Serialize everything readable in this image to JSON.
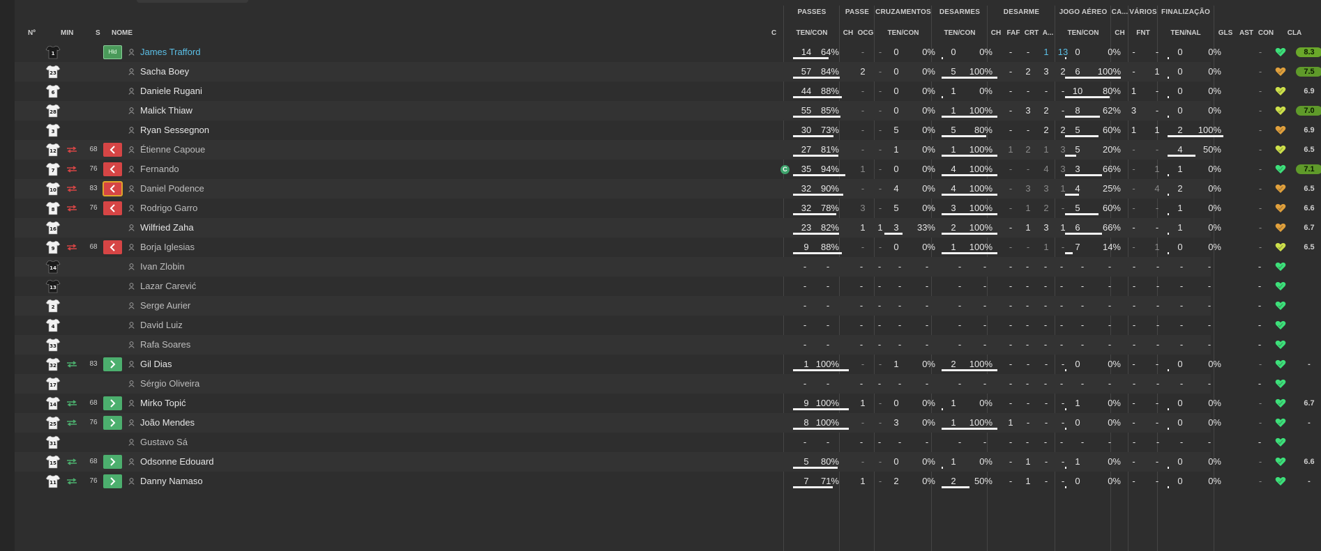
{
  "groups": [
    {
      "key": "passes",
      "label": "PASSES"
    },
    {
      "key": "passe",
      "label": "PASSE"
    },
    {
      "key": "cruz",
      "label": "CRUZAMENTOS"
    },
    {
      "key": "desarmes",
      "label": "DESARMES"
    },
    {
      "key": "desarme",
      "label": "DESARME"
    },
    {
      "key": "aereo",
      "label": "JOGO AÉREO"
    },
    {
      "key": "ca",
      "label": "CA..."
    },
    {
      "key": "varios",
      "label": "VÁRIOS"
    },
    {
      "key": "final",
      "label": "FINALIZAÇÃO"
    }
  ],
  "headers": {
    "num": "Nº",
    "min": "MIN",
    "s": "S",
    "nome": "NOME",
    "c": "C",
    "pass_tc": "TEN/CON",
    "passe_ch": "CH",
    "passe_ocg": "OCG",
    "cruz_tc": "TEN/CON",
    "des_tc": "TEN/CON",
    "d_ch": "CH",
    "d_faf": "FAF",
    "d_crt": "CRT",
    "d_a": "A...",
    "aer_tc": "TEN/CON",
    "ca_ch": "CH",
    "var_fnt": "FNT",
    "fin_tn": "TEN/NAL",
    "gls": "GLS",
    "ast": "AST",
    "con": "CON",
    "cla": "CLA"
  },
  "colors": {
    "sub_out": "#d64545",
    "sub_in": "#4caf6e",
    "link": "#5bbfe6",
    "heart_green": "#3de07a",
    "heart_yellow": "#cde04a",
    "heart_orange": "#e0a03c"
  },
  "players": [
    {
      "num": "1",
      "gk": true,
      "sub": "",
      "min": "",
      "s": "hld",
      "s_label": "Hld",
      "name": "James Trafford",
      "style": "link",
      "cap": "",
      "p1": "14",
      "p2": "64%",
      "pf": 0.64,
      "pch": "-",
      "pocg": "-",
      "c1": "0",
      "c2": "0%",
      "t1": "0",
      "t2": "0%",
      "tf": 0,
      "dch": "-",
      "dfaf": "-",
      "dcrt": "1",
      "da": "13",
      "dblue": true,
      "a1": "0",
      "a2": "0%",
      "af": 0,
      "cach": "-",
      "fnt": "-",
      "f1": "0",
      "f2": "0%",
      "ff": 0,
      "gls": "",
      "ast": "-",
      "heart": "green",
      "cla": "8.3",
      "cla_style": "best"
    },
    {
      "num": "23",
      "gk": false,
      "sub": "",
      "min": "",
      "s": "",
      "name": "Sacha Boey",
      "style": "white",
      "cap": "",
      "p1": "57",
      "p2": "84%",
      "pf": 0.84,
      "pch": "2",
      "pocg": "-",
      "c1": "0",
      "c2": "0%",
      "t1": "5",
      "t2": "100%",
      "tf": 1,
      "dch": "-",
      "dfaf": "2",
      "dcrt": "3",
      "da": "2",
      "a1": "6",
      "a2": "100%",
      "af": 1,
      "cach": "-",
      "fnt": "1",
      "f1": "0",
      "f2": "0%",
      "ff": 0,
      "gls": "",
      "ast": "-",
      "heart": "orange",
      "cla": "7.5",
      "cla_style": "good"
    },
    {
      "num": "6",
      "gk": false,
      "sub": "",
      "min": "",
      "s": "",
      "name": "Daniele Rugani",
      "style": "white",
      "cap": "",
      "p1": "44",
      "p2": "88%",
      "pf": 0.88,
      "pch": "-",
      "pocg": "-",
      "c1": "0",
      "c2": "0%",
      "t1": "1",
      "t2": "0%",
      "tf": 0,
      "dch": "-",
      "dfaf": "-",
      "dcrt": "-",
      "da": "-",
      "a1": "10",
      "a2": "80%",
      "af": 0.8,
      "cach": "1",
      "fnt": "-",
      "f1": "0",
      "f2": "0%",
      "ff": 0,
      "gls": "",
      "ast": "-",
      "heart": "yellow",
      "cla": "6.9",
      "cla_style": "plain"
    },
    {
      "num": "28",
      "gk": false,
      "sub": "",
      "min": "",
      "s": "",
      "name": "Malick Thiaw",
      "style": "white",
      "cap": "",
      "p1": "55",
      "p2": "85%",
      "pf": 0.85,
      "pch": "-",
      "pocg": "-",
      "c1": "0",
      "c2": "0%",
      "t1": "1",
      "t2": "100%",
      "tf": 1,
      "dch": "-",
      "dfaf": "3",
      "dcrt": "2",
      "da": "-",
      "a1": "8",
      "a2": "62%",
      "af": 0.62,
      "cach": "3",
      "fnt": "-",
      "f1": "0",
      "f2": "0%",
      "ff": 0,
      "gls": "",
      "ast": "-",
      "heart": "yellow",
      "cla": "7.0",
      "cla_style": "good"
    },
    {
      "num": "3",
      "gk": false,
      "sub": "",
      "min": "",
      "s": "",
      "name": "Ryan Sessegnon",
      "style": "white",
      "cap": "",
      "p1": "30",
      "p2": "73%",
      "pf": 0.73,
      "pch": "-",
      "pocg": "-",
      "c1": "5",
      "c2": "0%",
      "t1": "5",
      "t2": "80%",
      "tf": 0.8,
      "dch": "-",
      "dfaf": "-",
      "dcrt": "2",
      "da": "2",
      "a1": "5",
      "a2": "60%",
      "af": 0.6,
      "cach": "1",
      "fnt": "1",
      "f1": "2",
      "f2": "100%",
      "ff": 1,
      "gls": "",
      "ast": "-",
      "heart": "orange",
      "cla": "6.9",
      "cla_style": "plain"
    },
    {
      "num": "12",
      "gk": false,
      "sub": "out",
      "min": "68",
      "s": "out",
      "name": "Étienne Capoue",
      "style": "grey",
      "cap": "",
      "p1": "27",
      "p2": "81%",
      "pf": 0.81,
      "pch": "-",
      "pocg": "-",
      "c1": "1",
      "c2": "0%",
      "t1": "1",
      "t2": "100%",
      "tf": 1,
      "dch": "1",
      "dfaf": "2",
      "dcrt": "1",
      "da": "3",
      "a1": "5",
      "a2": "20%",
      "af": 0.2,
      "cach": "-",
      "fnt": "-",
      "f1": "4",
      "f2": "50%",
      "ff": 0.5,
      "gls": "",
      "ast": "-",
      "heart": "yellow",
      "cla": "6.5",
      "cla_style": "plain"
    },
    {
      "num": "7",
      "gk": false,
      "sub": "out",
      "min": "76",
      "s": "out",
      "name": "Fernando",
      "style": "grey",
      "cap": "C",
      "p1": "35",
      "p2": "94%",
      "pf": 0.94,
      "pch": "1",
      "pocg": "-",
      "c1": "0",
      "c2": "0%",
      "t1": "4",
      "t2": "100%",
      "tf": 1,
      "dch": "-",
      "dfaf": "-",
      "dcrt": "4",
      "da": "3",
      "a1": "3",
      "a2": "66%",
      "af": 0.66,
      "cach": "-",
      "fnt": "1",
      "f1": "1",
      "f2": "0%",
      "ff": 0,
      "gls": "",
      "ast": "-",
      "heart": "green",
      "cla": "7.1",
      "cla_style": "good"
    },
    {
      "num": "10",
      "gk": false,
      "sub": "out",
      "min": "83",
      "s": "out",
      "sel": true,
      "name": "Daniel Podence",
      "style": "grey",
      "cap": "",
      "p1": "32",
      "p2": "90%",
      "pf": 0.9,
      "pch": "-",
      "pocg": "-",
      "c1": "4",
      "c2": "0%",
      "t1": "4",
      "t2": "100%",
      "tf": 1,
      "dch": "-",
      "dfaf": "3",
      "dcrt": "3",
      "da": "1",
      "a1": "4",
      "a2": "25%",
      "af": 0.25,
      "cach": "-",
      "fnt": "4",
      "f1": "2",
      "f2": "0%",
      "ff": 0,
      "gls": "",
      "ast": "-",
      "heart": "orange",
      "cla": "6.5",
      "cla_style": "plain"
    },
    {
      "num": "8",
      "gk": false,
      "sub": "out",
      "min": "76",
      "s": "out",
      "name": "Rodrigo Garro",
      "style": "grey",
      "cap": "",
      "p1": "32",
      "p2": "78%",
      "pf": 0.78,
      "pch": "3",
      "pocg": "-",
      "c1": "5",
      "c2": "0%",
      "t1": "3",
      "t2": "100%",
      "tf": 1,
      "dch": "-",
      "dfaf": "1",
      "dcrt": "2",
      "da": "-",
      "a1": "5",
      "a2": "60%",
      "af": 0.6,
      "cach": "-",
      "fnt": "-",
      "f1": "1",
      "f2": "0%",
      "ff": 0,
      "gls": "",
      "ast": "-",
      "heart": "orange",
      "cla": "6.6",
      "cla_style": "plain"
    },
    {
      "num": "16",
      "gk": false,
      "sub": "",
      "min": "",
      "s": "",
      "name": "Wilfried Zaha",
      "style": "white",
      "cap": "",
      "p1": "23",
      "p2": "82%",
      "pf": 0.82,
      "pch": "1",
      "pocg": "1",
      "c1": "3",
      "c2": "33%",
      "cf": 0.33,
      "t1": "2",
      "t2": "100%",
      "tf": 1,
      "dch": "-",
      "dfaf": "1",
      "dcrt": "3",
      "da": "1",
      "a1": "6",
      "a2": "66%",
      "af": 0.66,
      "cach": "-",
      "fnt": "-",
      "f1": "1",
      "f2": "0%",
      "ff": 0,
      "gls": "",
      "ast": "-",
      "heart": "orange",
      "cla": "6.7",
      "cla_style": "plain"
    },
    {
      "num": "9",
      "gk": false,
      "sub": "out",
      "min": "68",
      "s": "out",
      "name": "Borja Iglesias",
      "style": "grey",
      "cap": "",
      "p1": "9",
      "p2": "88%",
      "pf": 0.88,
      "pch": "-",
      "pocg": "-",
      "c1": "0",
      "c2": "0%",
      "t1": "1",
      "t2": "100%",
      "tf": 1,
      "dch": "-",
      "dfaf": "-",
      "dcrt": "1",
      "da": "-",
      "a1": "7",
      "a2": "14%",
      "af": 0.14,
      "cach": "-",
      "fnt": "1",
      "f1": "0",
      "f2": "0%",
      "ff": 0,
      "gls": "",
      "ast": "-",
      "heart": "yellow",
      "cla": "6.5",
      "cla_style": "plain"
    },
    {
      "num": "14",
      "gk": true,
      "sub": "",
      "min": "",
      "s": "",
      "name": "Ivan Zlobin",
      "style": "grey",
      "cap": "",
      "empty": true,
      "heart": "green",
      "cla": "",
      "cla_style": "plain"
    },
    {
      "num": "13",
      "gk": true,
      "sub": "",
      "min": "",
      "s": "",
      "name": "Lazar Carević",
      "style": "grey",
      "cap": "",
      "empty": true,
      "heart": "green",
      "cla": "",
      "cla_style": "plain"
    },
    {
      "num": "2",
      "gk": false,
      "sub": "",
      "min": "",
      "s": "",
      "name": "Serge Aurier",
      "style": "grey",
      "cap": "",
      "empty": true,
      "heart": "green",
      "cla": "",
      "cla_style": "plain"
    },
    {
      "num": "4",
      "gk": false,
      "sub": "",
      "min": "",
      "s": "",
      "name": "David Luiz",
      "style": "grey",
      "cap": "",
      "empty": true,
      "heart": "green",
      "cla": "",
      "cla_style": "plain"
    },
    {
      "num": "33",
      "gk": false,
      "sub": "",
      "min": "",
      "s": "",
      "name": "Rafa Soares",
      "style": "grey",
      "cap": "",
      "empty": true,
      "heart": "green",
      "cla": "",
      "cla_style": "plain"
    },
    {
      "num": "32",
      "gk": false,
      "sub": "in",
      "min": "83",
      "s": "in",
      "name": "Gil Dias",
      "style": "white",
      "cap": "",
      "p1": "1",
      "p2": "100%",
      "pf": 1,
      "pch": "-",
      "pocg": "-",
      "c1": "1",
      "c2": "0%",
      "t1": "2",
      "t2": "100%",
      "tf": 1,
      "dch": "-",
      "dfaf": "-",
      "dcrt": "-",
      "da": "-",
      "a1": "0",
      "a2": "0%",
      "af": 0,
      "cach": "-",
      "fnt": "-",
      "f1": "0",
      "f2": "0%",
      "ff": 0,
      "gls": "",
      "ast": "-",
      "heart": "green",
      "cla": "-",
      "cla_style": "plain"
    },
    {
      "num": "17",
      "gk": false,
      "sub": "",
      "min": "",
      "s": "",
      "name": "Sérgio Oliveira",
      "style": "grey",
      "cap": "",
      "empty": true,
      "heart": "green",
      "cla": "",
      "cla_style": "plain"
    },
    {
      "num": "14",
      "gk": false,
      "sub": "in",
      "min": "68",
      "s": "in",
      "name": "Mirko Topić",
      "style": "white",
      "cap": "",
      "p1": "9",
      "p2": "100%",
      "pf": 1,
      "pch": "1",
      "pocg": "-",
      "c1": "0",
      "c2": "0%",
      "t1": "1",
      "t2": "0%",
      "tf": 0,
      "dch": "-",
      "dfaf": "-",
      "dcrt": "-",
      "da": "-",
      "a1": "1",
      "a2": "0%",
      "af": 0,
      "cach": "-",
      "fnt": "-",
      "f1": "0",
      "f2": "0%",
      "ff": 0,
      "gls": "",
      "ast": "-",
      "heart": "green",
      "cla": "6.7",
      "cla_style": "plain"
    },
    {
      "num": "25",
      "gk": false,
      "sub": "in",
      "min": "76",
      "s": "in",
      "name": "João Mendes",
      "style": "white",
      "cap": "",
      "p1": "8",
      "p2": "100%",
      "pf": 1,
      "pch": "-",
      "pocg": "-",
      "c1": "3",
      "c2": "0%",
      "t1": "1",
      "t2": "100%",
      "tf": 1,
      "dch": "1",
      "dfaf": "-",
      "dcrt": "-",
      "da": "-",
      "a1": "0",
      "a2": "0%",
      "af": 0,
      "cach": "-",
      "fnt": "-",
      "f1": "0",
      "f2": "0%",
      "ff": 0,
      "gls": "",
      "ast": "-",
      "heart": "green",
      "cla": "-",
      "cla_style": "plain"
    },
    {
      "num": "31",
      "gk": false,
      "sub": "",
      "min": "",
      "s": "",
      "name": "Gustavo Sá",
      "style": "grey",
      "cap": "",
      "empty": true,
      "heart": "green",
      "cla": "",
      "cla_style": "plain"
    },
    {
      "num": "15",
      "gk": false,
      "sub": "in",
      "min": "68",
      "s": "in",
      "name": "Odsonne Edouard",
      "style": "white",
      "cap": "",
      "p1": "5",
      "p2": "80%",
      "pf": 0.8,
      "pch": "-",
      "pocg": "-",
      "c1": "0",
      "c2": "0%",
      "t1": "1",
      "t2": "0%",
      "tf": 0,
      "dch": "-",
      "dfaf": "1",
      "dcrt": "-",
      "da": "-",
      "a1": "1",
      "a2": "0%",
      "af": 0,
      "cach": "-",
      "fnt": "-",
      "f1": "0",
      "f2": "0%",
      "ff": 0,
      "gls": "",
      "ast": "-",
      "heart": "green",
      "cla": "6.6",
      "cla_style": "plain"
    },
    {
      "num": "11",
      "gk": false,
      "sub": "in",
      "min": "76",
      "s": "in",
      "name": "Danny Namaso",
      "style": "white",
      "cap": "",
      "p1": "7",
      "p2": "71%",
      "pf": 0.71,
      "pch": "1",
      "pocg": "-",
      "c1": "2",
      "c2": "0%",
      "t1": "2",
      "t2": "50%",
      "tf": 0.5,
      "dch": "-",
      "dfaf": "1",
      "dcrt": "-",
      "da": "-",
      "a1": "0",
      "a2": "0%",
      "af": 0,
      "cach": "-",
      "fnt": "-",
      "f1": "0",
      "f2": "0%",
      "ff": 0,
      "gls": "",
      "ast": "-",
      "heart": "green",
      "cla": "-",
      "cla_style": "plain"
    }
  ]
}
